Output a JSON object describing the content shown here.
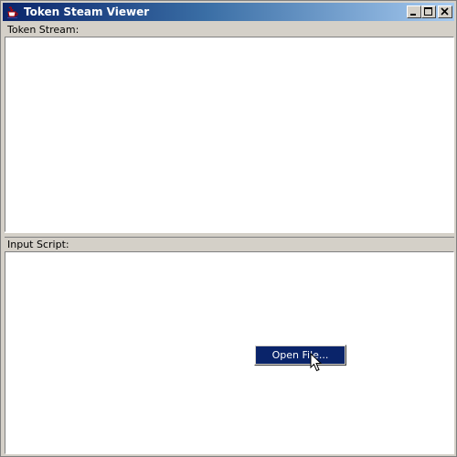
{
  "window": {
    "title": "Token Steam Viewer",
    "app_icon": "java-cup-icon",
    "buttons": [
      "minimize-icon",
      "maximize-icon",
      "close-icon"
    ]
  },
  "token_stream": {
    "label": "Token Stream:",
    "content": ""
  },
  "input_script": {
    "label": "Input Script:",
    "content": ""
  },
  "context_menu": {
    "items": [
      {
        "label": "Open File...",
        "highlighted": true
      }
    ]
  },
  "colors": {
    "titlebar_start": "#0a246a",
    "titlebar_end": "#a6caf0",
    "menu_highlight": "#0a246a",
    "window_background": "#d4d0c8"
  }
}
